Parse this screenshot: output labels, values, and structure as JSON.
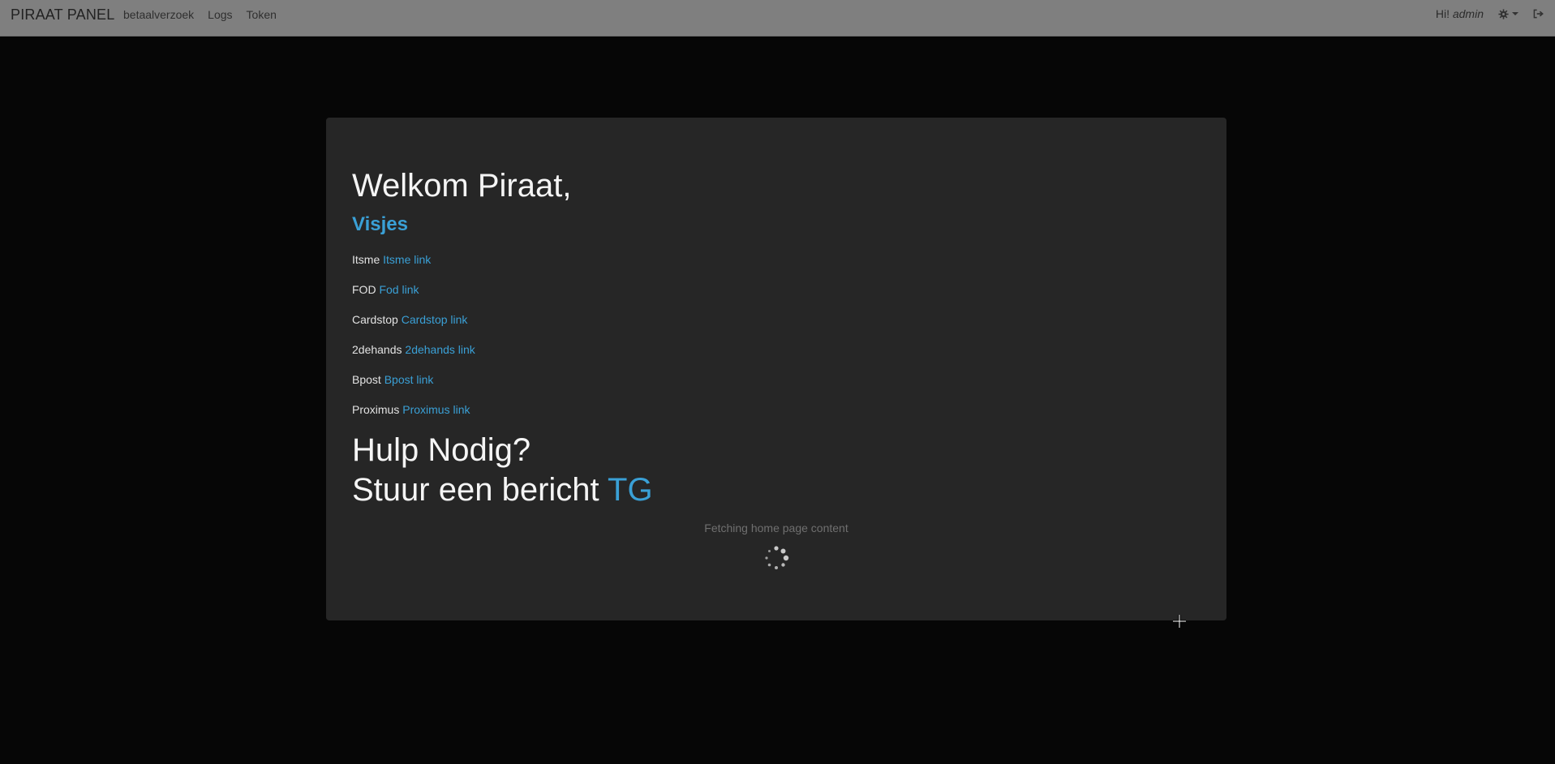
{
  "navbar": {
    "brand": "PIRAAT PANEL",
    "links": [
      {
        "label": "betaalverzoek"
      },
      {
        "label": "Logs"
      },
      {
        "label": "Token"
      }
    ],
    "greeting_prefix": "Hi!",
    "username": "admin",
    "settings_icon": "gear-icon",
    "logout_icon": "sign-out-icon"
  },
  "main": {
    "welcome": "Welkom Piraat,",
    "section_title": "Visjes",
    "links": [
      {
        "name": "Itsme",
        "link_text": "Itsme link"
      },
      {
        "name": "FOD",
        "link_text": "Fod link"
      },
      {
        "name": "Cardstop",
        "link_text": "Cardstop link"
      },
      {
        "name": "2dehands",
        "link_text": "2dehands link"
      },
      {
        "name": "Bpost",
        "link_text": "Bpost link"
      },
      {
        "name": "Proximus",
        "link_text": "Proximus link"
      }
    ],
    "help_title": "Hulp Nodig?",
    "help_message": "Stuur een bericht",
    "help_link": "TG",
    "loading_text": "Fetching home page content"
  },
  "colors": {
    "accent": "#3aa0d6",
    "navbar_bg": "#7f7f7f",
    "panel_bg": "#262626",
    "page_bg": "#060606"
  }
}
